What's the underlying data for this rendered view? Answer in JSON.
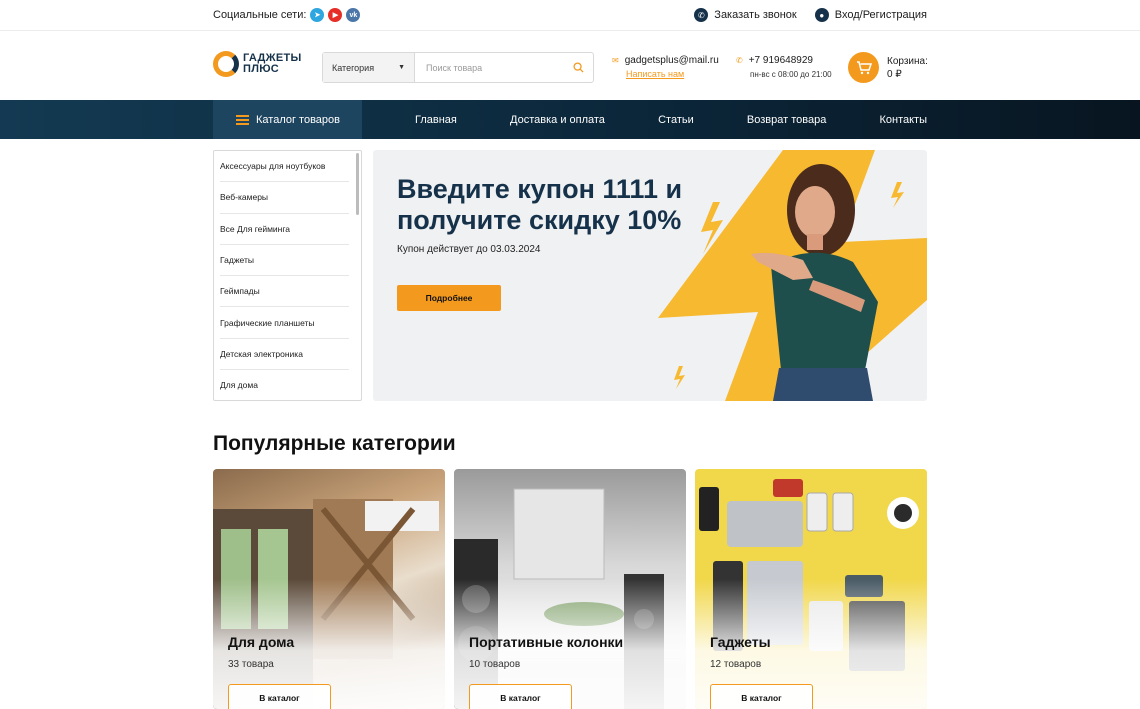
{
  "topbar": {
    "social_label": "Социальные сети:",
    "social_icons": [
      "telegram-icon",
      "youtube-icon",
      "vk-icon"
    ],
    "callback": "Заказать звонок",
    "login": "Вход/Регистрация"
  },
  "header": {
    "logo_line1": "ГАДЖЕТЫ",
    "logo_line2": "ПЛЮС",
    "search": {
      "category": "Категория",
      "placeholder": "Поиск товара"
    },
    "email": "gadgetsplus@mail.ru",
    "write_us": "Написать нам",
    "phone": "+7 919648929",
    "hours": "пн-вс с 08:00 до 21:00",
    "cart_label": "Корзина:",
    "cart_total": "0 ₽"
  },
  "nav": {
    "catalog": "Каталог товаров",
    "links": [
      "Главная",
      "Доставка и оплата",
      "Статьи",
      "Возврат товара",
      "Контакты"
    ]
  },
  "sidebar": {
    "items": [
      "Аксессуары для ноутбуков",
      "Веб-камеры",
      "Все Для гейминга",
      "Гаджеты",
      "Геймпады",
      "Графические планшеты",
      "Детская электроника",
      "Для дома"
    ]
  },
  "banner": {
    "title_line1": "Введите купон 1111 и",
    "title_line2": "получите скидку 10%",
    "subtitle": "Купон действует до 03.03.2024",
    "button": "Подробнее"
  },
  "popular": {
    "title": "Популярные категории",
    "cards": [
      {
        "name": "Для дома",
        "count": "33 товара",
        "button": "В каталог"
      },
      {
        "name": "Портативные колонки",
        "count": "10 товаров",
        "button": "В каталог"
      },
      {
        "name": "Гаджеты",
        "count": "12 товаров",
        "button": "В каталог"
      }
    ]
  },
  "colors": {
    "accent": "#f39a1e",
    "dark": "#16324a"
  }
}
